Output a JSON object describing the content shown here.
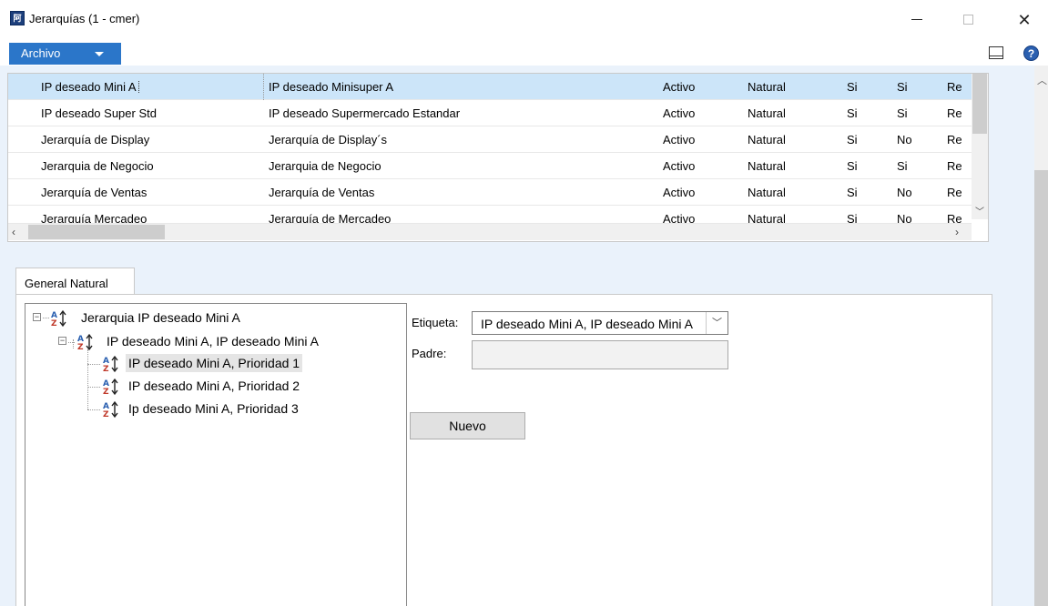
{
  "window": {
    "title": "Jerarquías (1 - cmer)",
    "app_icon_text": "阿"
  },
  "menu": {
    "archivo_label": "Archivo"
  },
  "grid": {
    "rows": [
      [
        "IP deseado Mini A",
        "IP deseado Minisuper A",
        "Activo",
        "Natural",
        "Si",
        "Si",
        "Re"
      ],
      [
        "IP deseado Super Std",
        "IP deseado Supermercado Estandar",
        "Activo",
        "Natural",
        "Si",
        "Si",
        "Re"
      ],
      [
        "Jerarquía de Display",
        "Jerarquía de Display´s",
        "Activo",
        "Natural",
        "Si",
        "No",
        "Re"
      ],
      [
        "Jerarquia de Negocio",
        "Jerarquia de Negocio",
        "Activo",
        "Natural",
        "Si",
        "Si",
        "Re"
      ],
      [
        "Jerarquía de Ventas",
        "Jerarquía de Ventas",
        "Activo",
        "Natural",
        "Si",
        "No",
        "Re"
      ],
      [
        "Jerarquía Mercadeo",
        "Jerarquía de Mercadeo",
        "Activo",
        "Natural",
        "Si",
        "No",
        "Re"
      ]
    ],
    "selected_row": 0
  },
  "tab": {
    "label": "General Natural"
  },
  "tree": {
    "nodes": [
      {
        "label": "Jerarquia IP deseado Mini A",
        "expander": "−"
      },
      {
        "label": "IP deseado Mini A, IP deseado Mini A",
        "expander": "−"
      },
      {
        "label": "IP deseado Mini A, Prioridad 1",
        "selected": true
      },
      {
        "label": "IP deseado Mini A, Prioridad 2"
      },
      {
        "label": "Ip deseado Mini A, Prioridad 3"
      }
    ]
  },
  "form": {
    "etiqueta_label": "Etiqueta:",
    "etiqueta_value": "IP deseado Mini A, IP deseado Mini A",
    "padre_label": "Padre:",
    "padre_value": "",
    "nuevo_label": "Nuevo"
  },
  "colors": {
    "accent": "#2b76c9",
    "selection": "#cce5f9",
    "panel_bg": "#eaf2fb"
  },
  "icons": [
    "app-icon",
    "chevron-down-icon",
    "layout-icon",
    "help-icon",
    "sort-az-icon",
    "minimize-icon",
    "maximize-icon",
    "close-icon"
  ]
}
